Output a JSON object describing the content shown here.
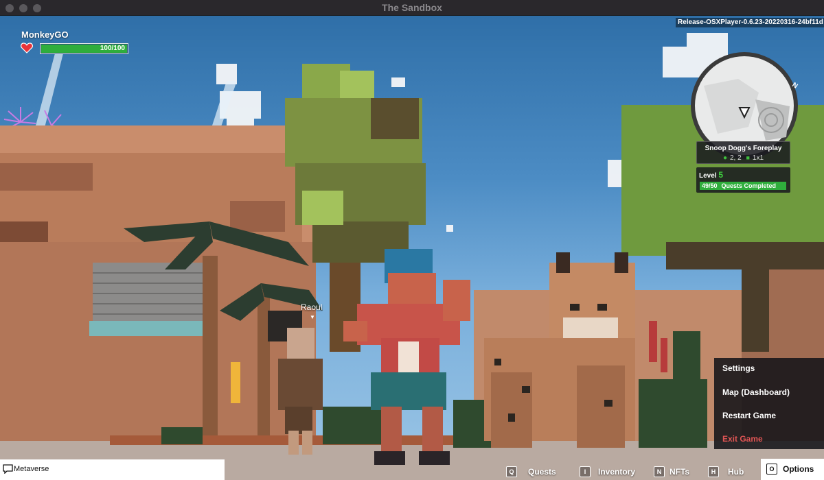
{
  "window": {
    "title": "The Sandbox"
  },
  "build_info": "Release-OSXPlayer-0.6.23-20220316-24bf11d",
  "player": {
    "name": "MonkeyGO",
    "health_text": "100/100",
    "health_fraction": 1.0
  },
  "location": {
    "name": "Snoop Dogg's Foreplay",
    "coords": "2, 2",
    "size": "1x1"
  },
  "level": {
    "label": "Level",
    "value": "5",
    "quests_progress": "49/50",
    "quests_label": "Quests Completed",
    "quests_fraction": 0.98
  },
  "npc": {
    "name": "Raoul"
  },
  "menu": {
    "items": [
      {
        "label": "Settings"
      },
      {
        "label": "Map (Dashboard)"
      },
      {
        "label": "Restart Game"
      },
      {
        "label": "Exit Game"
      }
    ]
  },
  "bottom_bar": {
    "metaverse_label": "Metaverse",
    "hotkeys": [
      {
        "key": "Q",
        "label": "Quests"
      },
      {
        "key": "I",
        "label": "Inventory"
      },
      {
        "key": "N",
        "label": "NFTs"
      },
      {
        "key": "H",
        "label": "Hub"
      }
    ],
    "options": {
      "key": "O",
      "label": "Options"
    }
  },
  "colors": {
    "health": "#2fae3c",
    "level_accent": "#3fd23f",
    "exit": "#e05555"
  }
}
